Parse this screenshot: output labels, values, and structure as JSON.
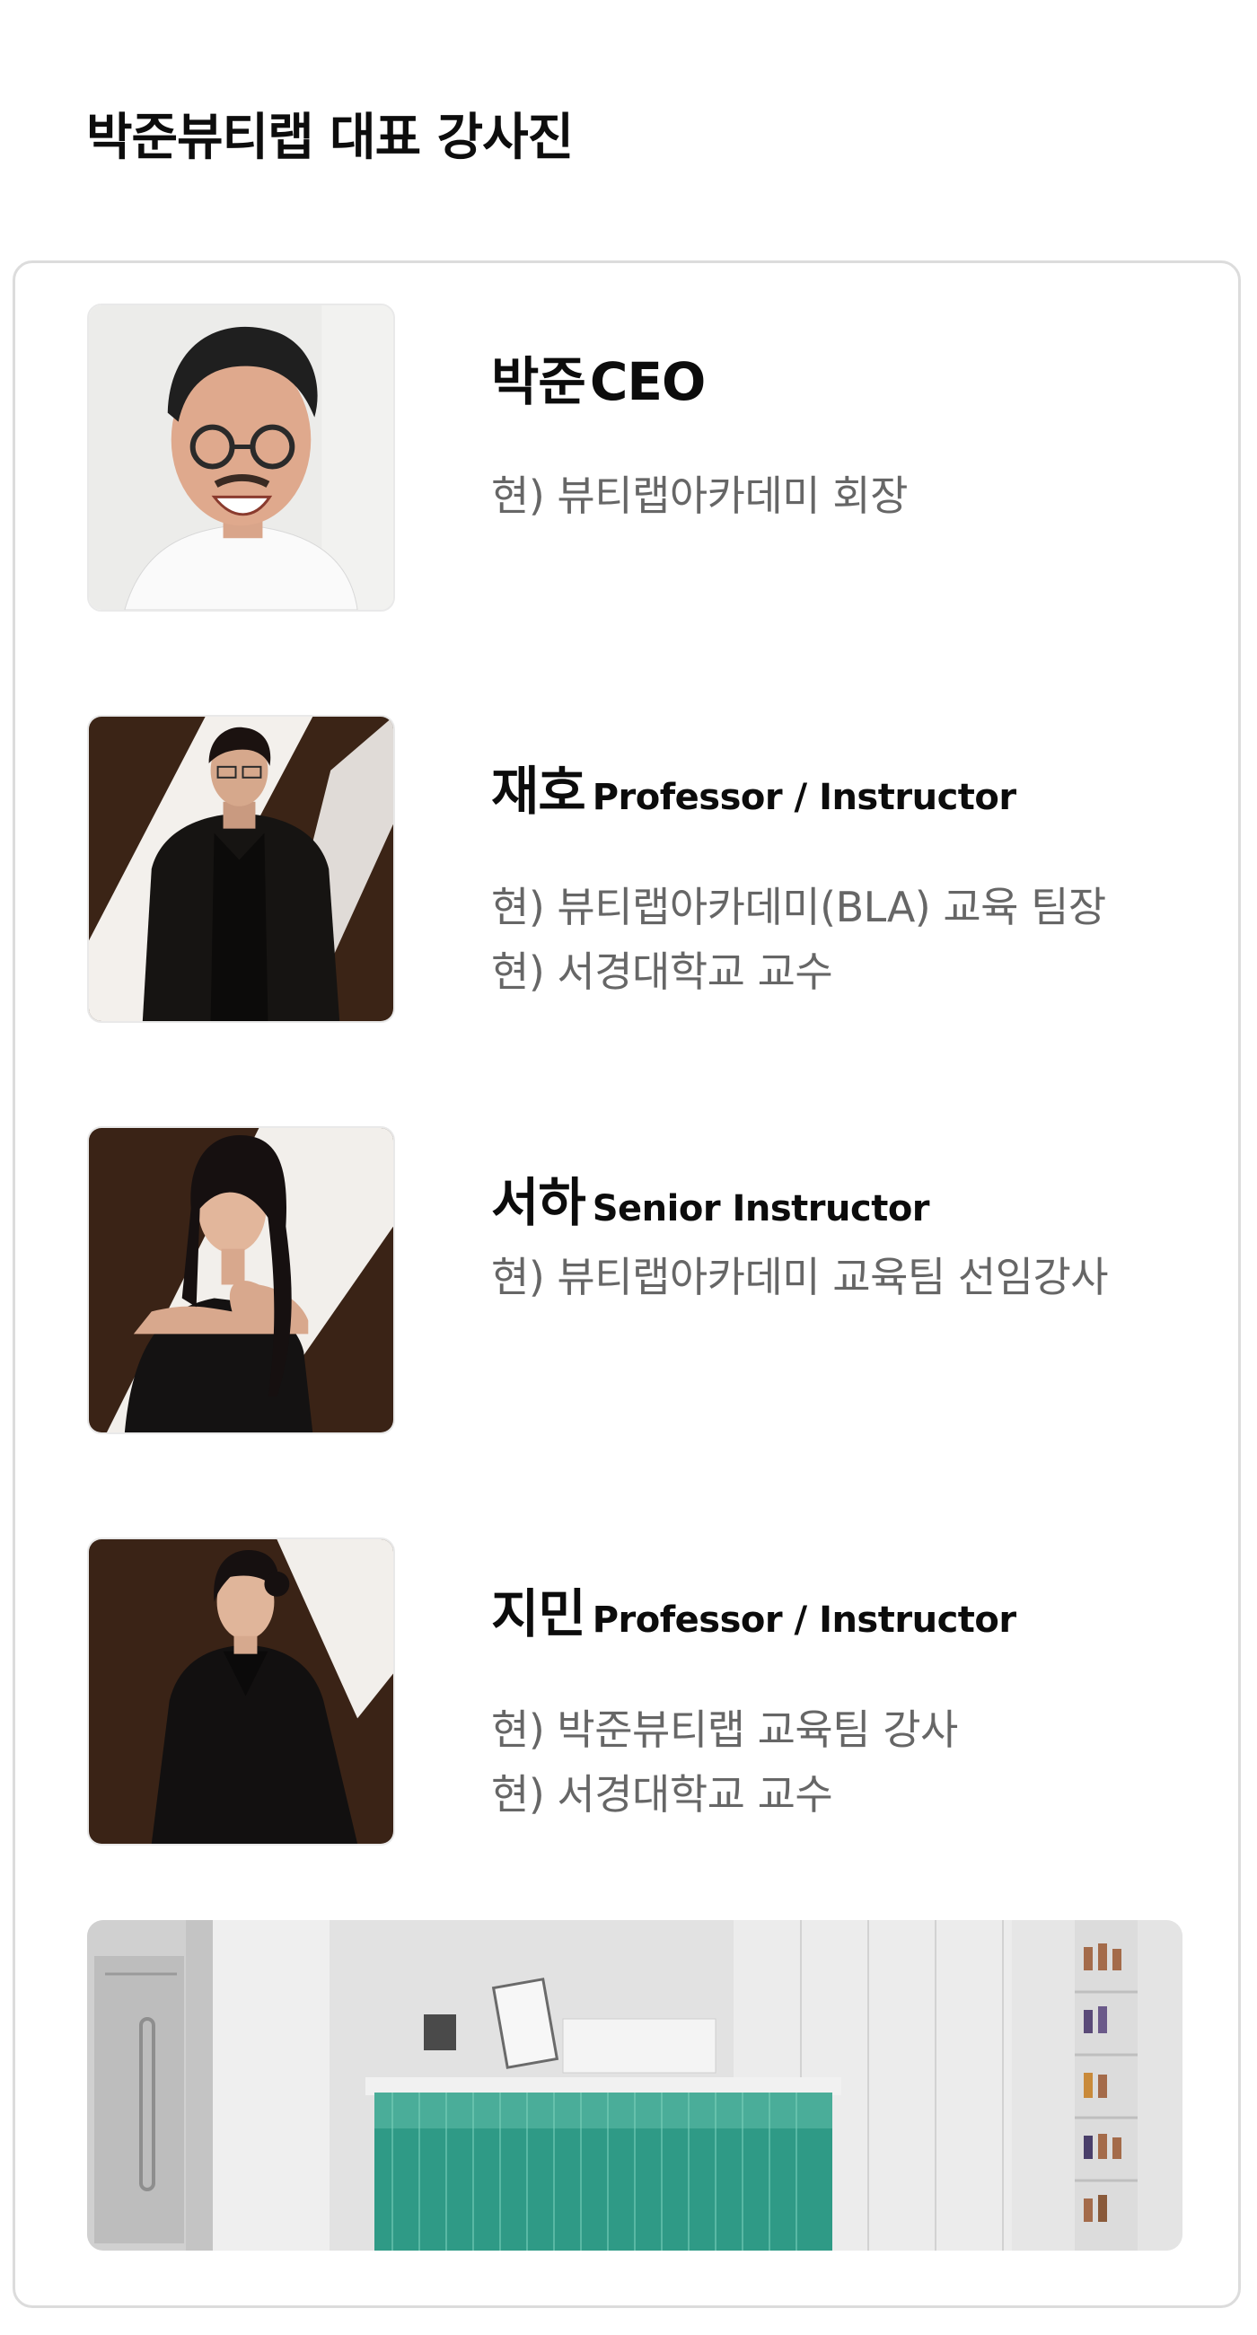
{
  "section": {
    "title": "박준뷰티랩 대표 강사진"
  },
  "instructors": [
    {
      "name": "박준",
      "title_en": "CEO",
      "lines": [
        "현) 뷰티랩아카데미 회장"
      ]
    },
    {
      "name": "재호",
      "title_en": "Professor / Instructor",
      "lines": [
        "현) 뷰티랩아카데미(BLA) 교육 팀장",
        "현) 서경대학교 교수"
      ]
    },
    {
      "name": "서하",
      "title_en": "Senior Instructor",
      "lines": [
        "현) 뷰티랩아카데미 교육팀 선임강사"
      ]
    },
    {
      "name": "지민",
      "title_en": "Professor / Instructor",
      "lines": [
        "현) 박준뷰티랩 교육팀 강사",
        "현) 서경대학교 교수"
      ]
    }
  ],
  "colors": {
    "card_border": "#dcdcdc",
    "desc_text": "#666666",
    "photo_backdrop_dark": "#3a2316",
    "reception_desk": "#2f9a86"
  }
}
